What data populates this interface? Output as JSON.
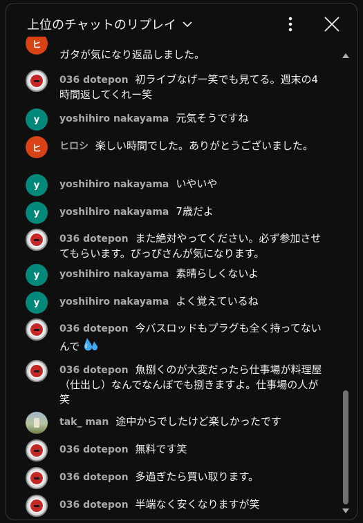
{
  "header": {
    "title": "上位のチャットのリプレイ",
    "more_icon": "more-vert-icon",
    "close_icon": "close-icon"
  },
  "colors": {
    "background": "#0f0f0f",
    "author_text": "#aaaaaa",
    "avatar_y": "#00897b",
    "avatar_hi": "#d84315"
  },
  "messages": [
    {
      "author": "",
      "text": "ガタが気になり返品しました。",
      "avatar": "ヒ",
      "avatar_type": "hi"
    },
    {
      "author": "036 dotepon",
      "text": "初ライブなげー笑でも見てる。週末の4時間返してくれー笑",
      "avatar": "",
      "avatar_type": "dote"
    },
    {
      "author": "yoshihiro nakayama",
      "text": "元気そうですね",
      "avatar": "y",
      "avatar_type": "y"
    },
    {
      "author": "ヒロシ",
      "text": "楽しい時間でした。ありがとうございました。",
      "avatar": "ヒ",
      "avatar_type": "hi"
    },
    {
      "author": "yoshihiro nakayama",
      "text": "いやいや",
      "avatar": "y",
      "avatar_type": "y"
    },
    {
      "author": "yoshihiro nakayama",
      "text": "7歳だよ",
      "avatar": "y",
      "avatar_type": "y"
    },
    {
      "author": "036 dotepon",
      "text": "また絶対やってください。必ず参加させてもらいます。ぴっぴさんが気になります。",
      "avatar": "",
      "avatar_type": "dote"
    },
    {
      "author": "yoshihiro nakayama",
      "text": "素晴らしくないよ",
      "avatar": "y",
      "avatar_type": "y"
    },
    {
      "author": "yoshihiro nakayama",
      "text": "よく覚えているね",
      "avatar": "y",
      "avatar_type": "y"
    },
    {
      "author": "036 dotepon",
      "text": "今バスロッドもプラグも全く持ってないんで",
      "avatar": "",
      "avatar_type": "dote",
      "emoji": "sweat-droplets-icon"
    },
    {
      "author": "036 dotepon",
      "text": "魚捌くのが大変だったら仕事場が料理屋（仕出し）なんでなんぼでも捌きますよ。仕事場の人が笑",
      "avatar": "",
      "avatar_type": "dote"
    },
    {
      "author": "tak_ man",
      "text": "途中からでしたけど楽しかったです",
      "avatar": "",
      "avatar_type": "tak"
    },
    {
      "author": "036 dotepon",
      "text": "無料です笑",
      "avatar": "",
      "avatar_type": "dote"
    },
    {
      "author": "036 dotepon",
      "text": "多過ぎたら買い取ります。",
      "avatar": "",
      "avatar_type": "dote"
    },
    {
      "author": "036 dotepon",
      "text": "半端なく安くなりますが笑",
      "avatar": "",
      "avatar_type": "dote"
    }
  ]
}
